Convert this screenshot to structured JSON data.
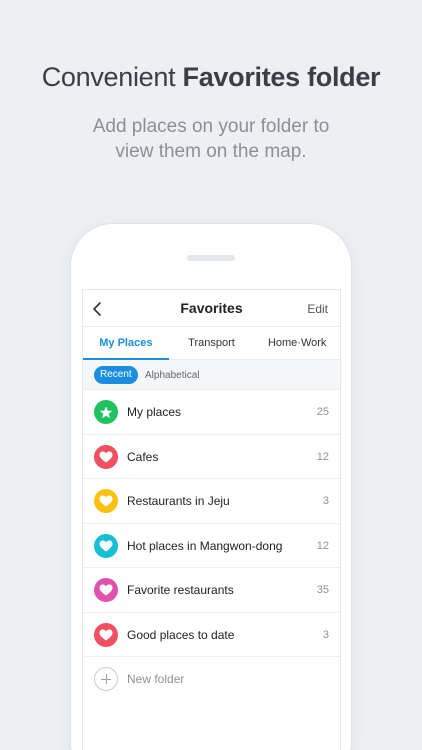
{
  "promo": {
    "headline_light": "Convenient ",
    "headline_bold": "Favorites folder",
    "sub_line1": "Add places on your folder to",
    "sub_line2": "view them on the map."
  },
  "navbar": {
    "back_icon": "chevron-left-icon",
    "title": "Favorites",
    "edit_label": "Edit"
  },
  "tabs": [
    {
      "label": "My Places",
      "active": true
    },
    {
      "label": "Transport",
      "active": false
    },
    {
      "label": "Home·Work",
      "active": false
    }
  ],
  "sort": {
    "recent_label": "Recent",
    "alphabetical_label": "Alphabetical"
  },
  "folders": [
    {
      "label": "My places",
      "count": "25",
      "icon": "star-icon",
      "color": "#1fc25f"
    },
    {
      "label": "Cafes",
      "count": "12",
      "icon": "heart-icon",
      "color": "#f0505f"
    },
    {
      "label": "Restaurants in Jeju",
      "count": "3",
      "icon": "heart-icon",
      "color": "#f8c20f"
    },
    {
      "label": "Hot places in Mangwon-dong",
      "count": "12",
      "icon": "heart-icon",
      "color": "#15bfd4"
    },
    {
      "label": "Favorite restaurants",
      "count": "35",
      "icon": "heart-icon",
      "color": "#e052ac"
    },
    {
      "label": "Good places to date",
      "count": "3",
      "icon": "heart-icon",
      "color": "#f0505f"
    }
  ],
  "new_folder": {
    "label": "New folder",
    "icon": "plus-icon"
  },
  "colors": {
    "accent": "#1b8ee0",
    "background": "#edf0f3"
  }
}
